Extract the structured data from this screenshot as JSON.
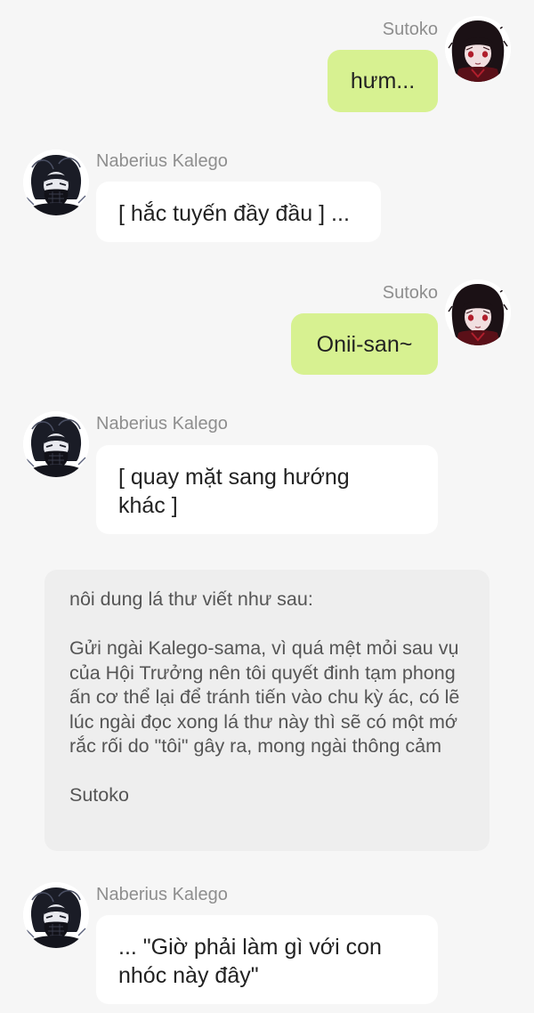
{
  "messages": [
    {
      "sender": "Sutoko",
      "text": "hưm...",
      "direction": "outgoing",
      "avatar": "sutoko-avatar"
    },
    {
      "sender": "Naberius Kalego",
      "text": "[ hắc tuyến đầy đầu ] ...",
      "direction": "incoming",
      "avatar": "kalego-avatar"
    },
    {
      "sender": "Sutoko",
      "text": "Onii-san~",
      "direction": "outgoing",
      "avatar": "sutoko-avatar"
    },
    {
      "sender": "Naberius Kalego",
      "text": "[ quay mặt sang hướng khác ]",
      "direction": "incoming",
      "avatar": "kalego-avatar"
    },
    {
      "sender": "Naberius Kalego",
      "text": "... \"Giờ phải làm gì với con nhóc này đây\"",
      "direction": "incoming",
      "avatar": "kalego-avatar"
    }
  ],
  "narration": {
    "intro": "nôi dung lá thư viết như sau:",
    "body": "Gửi ngài Kalego-sama, vì quá mệt mỏi sau vụ của Hội Trưởng nên tôi quyết đinh tạm phong ấn cơ thể lại để tránh tiến vào chu kỳ ác, có lẽ lúc ngài đọc xong lá thư này thì sẽ có một mớ rắc rối do \"tôi\" gây ra, mong ngài thông cảm",
    "signature": "Sutoko"
  },
  "colors": {
    "background": "#f6f6f6",
    "outgoing_bubble": "#d7f191",
    "incoming_bubble": "#ffffff",
    "narration_bubble": "#eeeeee",
    "sender_name": "#8e8e8e"
  }
}
